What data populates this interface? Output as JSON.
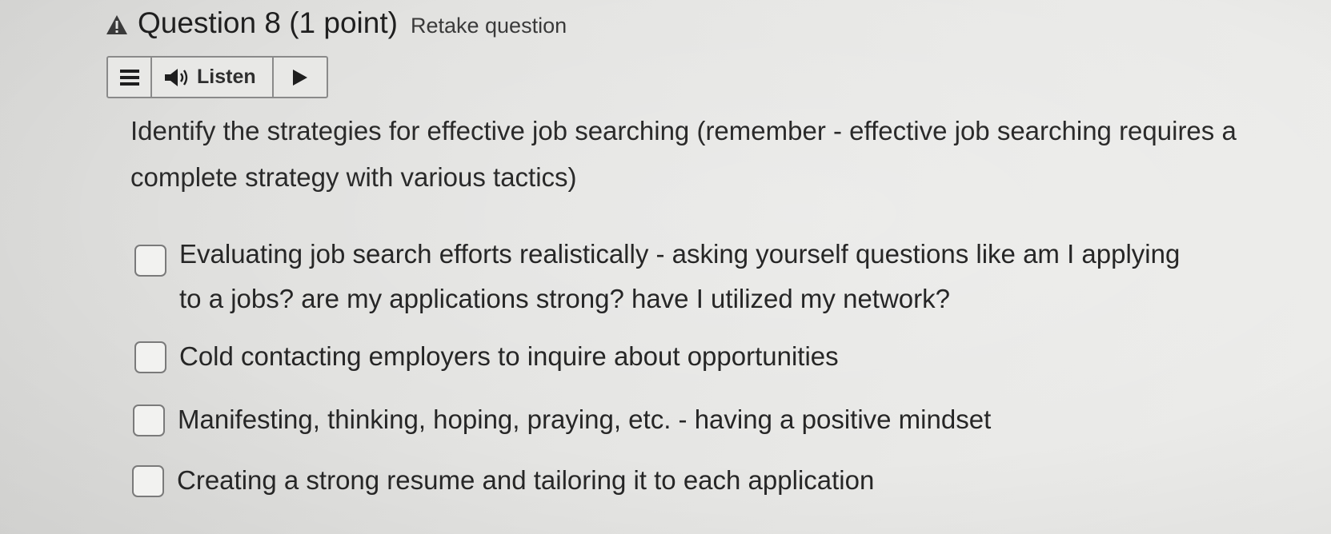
{
  "header": {
    "warning_icon": "warning-triangle-icon",
    "title": "Question 8 (1 point)",
    "retake_label": "Retake question"
  },
  "toolbar": {
    "menu_icon": "hamburger-menu-icon",
    "speaker_icon": "speaker-icon",
    "listen_label": "Listen",
    "play_icon": "play-icon"
  },
  "question": {
    "prompt": "Identify the strategies for effective job searching (remember - effective job searching requires a complete strategy with various tactics)",
    "options": [
      {
        "label": "Evaluating job search efforts realistically - asking yourself questions like am I applying to a jobs? are my applications strong? have I utilized my network?",
        "checked": false
      },
      {
        "label": "Cold contacting employers to inquire about opportunities",
        "checked": false
      },
      {
        "label": "Manifesting, thinking, hoping, praying, etc. - having a positive mindset",
        "checked": false
      },
      {
        "label": "Creating a strong resume and tailoring it to each application",
        "checked": false
      }
    ]
  },
  "colors": {
    "background": "#e6e6e4",
    "text": "#2a2a2a",
    "border": "#8a8a8a",
    "warning": "#3a3a3a"
  }
}
